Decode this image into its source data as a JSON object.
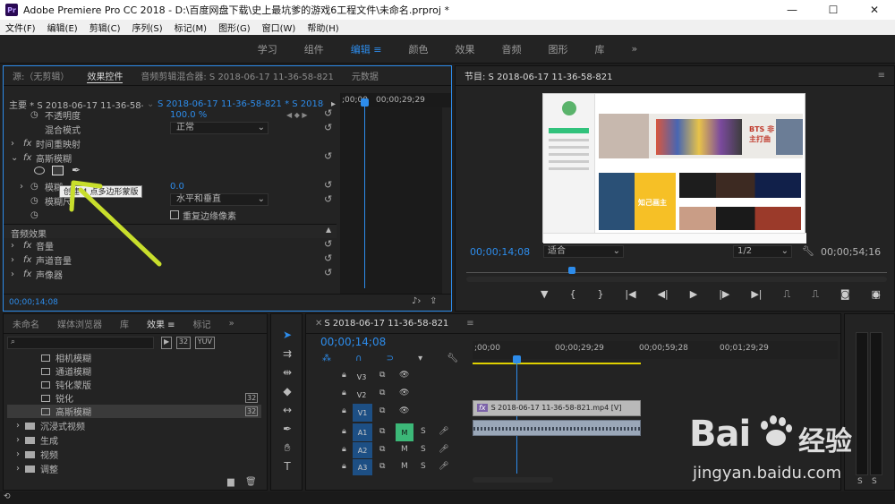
{
  "window": {
    "title": "Adobe Premiere Pro CC 2018 - D:\\百度网盘下载\\史上最坑爹的游戏6工程文件\\未命名.prproj *",
    "logo": "Pr",
    "min_icon": "minimize-icon",
    "max_icon": "maximize-icon",
    "close_icon": "close-icon"
  },
  "menu": [
    "文件(F)",
    "编辑(E)",
    "剪辑(C)",
    "序列(S)",
    "标记(M)",
    "图形(G)",
    "窗口(W)",
    "帮助(H)"
  ],
  "workspaces": [
    "学习",
    "组件",
    "编辑",
    "颜色",
    "效果",
    "音频",
    "图形",
    "库"
  ],
  "workspace_more": "»",
  "effect_controls": {
    "tabs": [
      "源:（无剪辑）",
      "效果控件",
      "音频剪辑混合器: S 2018-06-17 11-36-58-821",
      "元数据"
    ],
    "master": "主要 * S 2018-06-17 11-36-58-821.mp4",
    "sequence": "S 2018-06-17 11-36-58-821 * S 2018-06-17 11-...",
    "ruler_start": ";00;00",
    "ruler_mid": "00;00;29;29",
    "opacity_label": "不透明度",
    "opacity_value": "100.0 %",
    "blend_label": "混合模式",
    "blend_value": "正常",
    "time_remap": "时间重映射",
    "fx_prefix": "fx",
    "gaussian": "高斯模糊",
    "blur_label": "模糊",
    "blur_value": "0.0",
    "blur_dim_label": "模糊尺",
    "blur_dim_value": "水平和垂直",
    "repeat_edge": "重复边缘像素",
    "tooltip": "创建 4 点多边形蒙版",
    "audio_effects": "音频效果",
    "volume": "音量",
    "channel_volume": "声道音量",
    "panner": "声像器",
    "timecode": "00;00;14;08"
  },
  "program": {
    "title": "节目: S 2018-06-17 11-36-58-821",
    "timecode": "00;00;14;08",
    "fit": "适合",
    "quality": "1/2",
    "duration": "00;00;54;16",
    "embedded_banner": "BTS 非主打曲",
    "embedded_album": "知己画主"
  },
  "project": {
    "tabs": [
      "未命名",
      "媒体浏览器",
      "库",
      "效果",
      "标记"
    ],
    "items": [
      "相机模糊",
      "通道模糊",
      "钝化蒙版",
      "锐化",
      "高斯模糊"
    ],
    "folders": [
      "沉浸式视频",
      "生成",
      "视频",
      "调整"
    ]
  },
  "timeline": {
    "tab": "S 2018-06-17 11-36-58-821",
    "timecode": "00;00;14;08",
    "ruler": [
      ";00;00",
      "00;00;29;29",
      "00;00;59;28",
      "00;01;29;29"
    ],
    "video_tracks": [
      "V3",
      "V2",
      "V1"
    ],
    "audio_tracks": [
      "A1",
      "A2",
      "A3"
    ],
    "clip_label": "S 2018-06-17 11-36-58-821.mp4 [V]",
    "m": "M",
    "s": "S",
    "fx_badge": "fx"
  },
  "meter": {
    "s1": "S",
    "s2": "S"
  },
  "watermark": {
    "brand": "Bai",
    "brand2": "经验",
    "url": "jingyan.baidu.com"
  },
  "colors": {
    "accent": "#2d8ceb",
    "arrow": "#c8de2c",
    "clip": "#b9b9b9",
    "audio_clip": "#9aa7b8"
  }
}
